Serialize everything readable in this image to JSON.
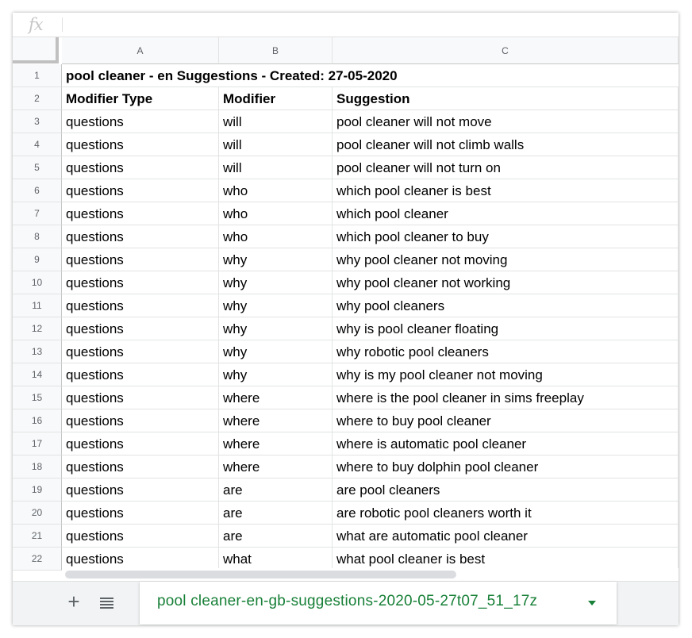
{
  "formula_bar": {
    "icon": "fx-icon",
    "value": ""
  },
  "columns": [
    "A",
    "B",
    "C"
  ],
  "title_row": {
    "row": "1",
    "text": "pool cleaner - en Suggestions - Created: 27-05-2020"
  },
  "header_row": {
    "row": "2",
    "cells": [
      "Modifier Type",
      "Modifier",
      "Suggestion"
    ]
  },
  "rows": [
    {
      "row": "3",
      "type": "questions",
      "modifier": "will",
      "suggestion": "pool cleaner will not move"
    },
    {
      "row": "4",
      "type": "questions",
      "modifier": "will",
      "suggestion": "pool cleaner will not climb walls"
    },
    {
      "row": "5",
      "type": "questions",
      "modifier": "will",
      "suggestion": "pool cleaner will not turn on"
    },
    {
      "row": "6",
      "type": "questions",
      "modifier": "who",
      "suggestion": "which pool cleaner is best"
    },
    {
      "row": "7",
      "type": "questions",
      "modifier": "who",
      "suggestion": "which pool cleaner"
    },
    {
      "row": "8",
      "type": "questions",
      "modifier": "who",
      "suggestion": "which pool cleaner to buy"
    },
    {
      "row": "9",
      "type": "questions",
      "modifier": "why",
      "suggestion": "why pool cleaner not moving"
    },
    {
      "row": "10",
      "type": "questions",
      "modifier": "why",
      "suggestion": "why pool cleaner not working"
    },
    {
      "row": "11",
      "type": "questions",
      "modifier": "why",
      "suggestion": "why pool cleaners"
    },
    {
      "row": "12",
      "type": "questions",
      "modifier": "why",
      "suggestion": "why is pool cleaner floating"
    },
    {
      "row": "13",
      "type": "questions",
      "modifier": "why",
      "suggestion": "why robotic pool cleaners"
    },
    {
      "row": "14",
      "type": "questions",
      "modifier": "why",
      "suggestion": "why is my pool cleaner not moving"
    },
    {
      "row": "15",
      "type": "questions",
      "modifier": "where",
      "suggestion": "where is the pool cleaner in sims freeplay"
    },
    {
      "row": "16",
      "type": "questions",
      "modifier": "where",
      "suggestion": "where to buy pool cleaner"
    },
    {
      "row": "17",
      "type": "questions",
      "modifier": "where",
      "suggestion": "where is automatic pool cleaner"
    },
    {
      "row": "18",
      "type": "questions",
      "modifier": "where",
      "suggestion": "where to buy dolphin pool cleaner"
    },
    {
      "row": "19",
      "type": "questions",
      "modifier": "are",
      "suggestion": "are pool cleaners"
    },
    {
      "row": "20",
      "type": "questions",
      "modifier": "are",
      "suggestion": "are robotic pool cleaners worth it"
    },
    {
      "row": "21",
      "type": "questions",
      "modifier": "are",
      "suggestion": "what are automatic pool cleaner"
    },
    {
      "row": "22",
      "type": "questions",
      "modifier": "what",
      "suggestion": "what pool cleaner is best"
    }
  ],
  "tabs_bar": {
    "add_icon": "plus-icon",
    "list_icon": "list-icon",
    "active_sheet": "pool cleaner-en-gb-suggestions-2020-05-27t07_51_17z",
    "active_color": "#188038"
  }
}
